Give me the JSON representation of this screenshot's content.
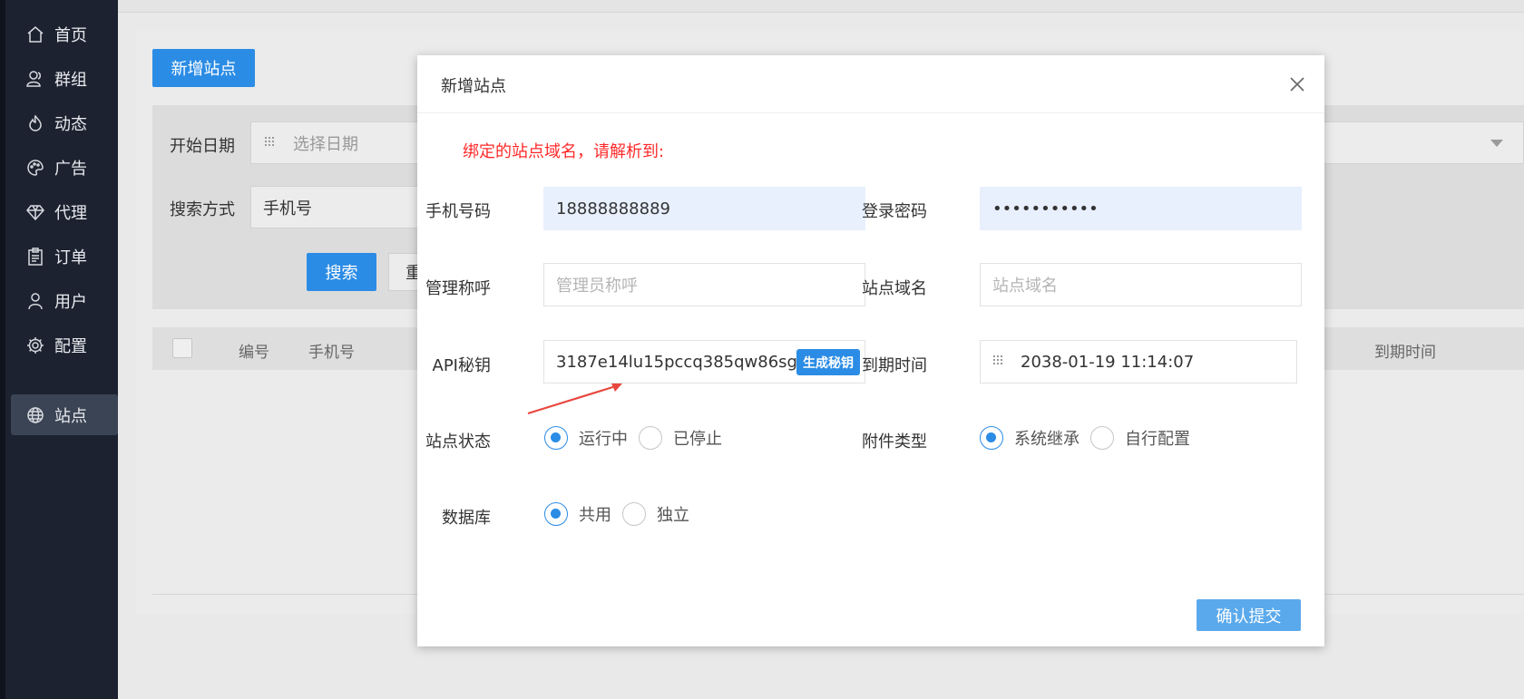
{
  "sidebar": {
    "items": [
      {
        "label": "首页",
        "icon": "home-icon"
      },
      {
        "label": "群组",
        "icon": "group-icon"
      },
      {
        "label": "动态",
        "icon": "fire-icon"
      },
      {
        "label": "广告",
        "icon": "palette-icon"
      },
      {
        "label": "代理",
        "icon": "diamond-icon"
      },
      {
        "label": "订单",
        "icon": "clipboard-icon"
      },
      {
        "label": "用户",
        "icon": "user-icon"
      },
      {
        "label": "配置",
        "icon": "gear-icon"
      },
      {
        "label": "站点",
        "icon": "globe-icon",
        "active": true
      }
    ]
  },
  "page": {
    "add_button": "新增站点",
    "filters": {
      "start_date_label": "开始日期",
      "start_date_placeholder": "选择日期",
      "search_mode_label": "搜索方式",
      "search_mode_value": "手机号",
      "search_button": "搜索",
      "reset_button": "重"
    },
    "table": {
      "headers": [
        "编号",
        "手机号",
        "到期时间"
      ]
    }
  },
  "modal": {
    "title": "新增站点",
    "notice": "绑定的站点域名，请解析到:",
    "phone_label": "手机号码",
    "phone_value": "18888888889",
    "password_label": "登录密码",
    "password_value": "•••••••••••",
    "admin_label": "管理称呼",
    "admin_placeholder": "管理员称呼",
    "domain_label": "站点域名",
    "domain_placeholder": "站点域名",
    "api_label": "API秘钥",
    "api_value": "3187e14lu15pccq385qw86sgwm84",
    "generate_button": "生成秘钥",
    "expire_label": "到期时间",
    "expire_value": "2038-01-19 11:14:07",
    "status_label": "站点状态",
    "status_options": [
      "运行中",
      "已停止"
    ],
    "attach_label": "附件类型",
    "attach_options": [
      "系统继承",
      "自行配置"
    ],
    "db_label": "数据库",
    "db_options": [
      "共用",
      "独立"
    ],
    "submit_button": "确认提交"
  },
  "colors": {
    "accent": "#2b8ce5",
    "sidebar_bg": "#1c2230",
    "notice": "#ff2a2a",
    "arrow": "#e8473f"
  }
}
